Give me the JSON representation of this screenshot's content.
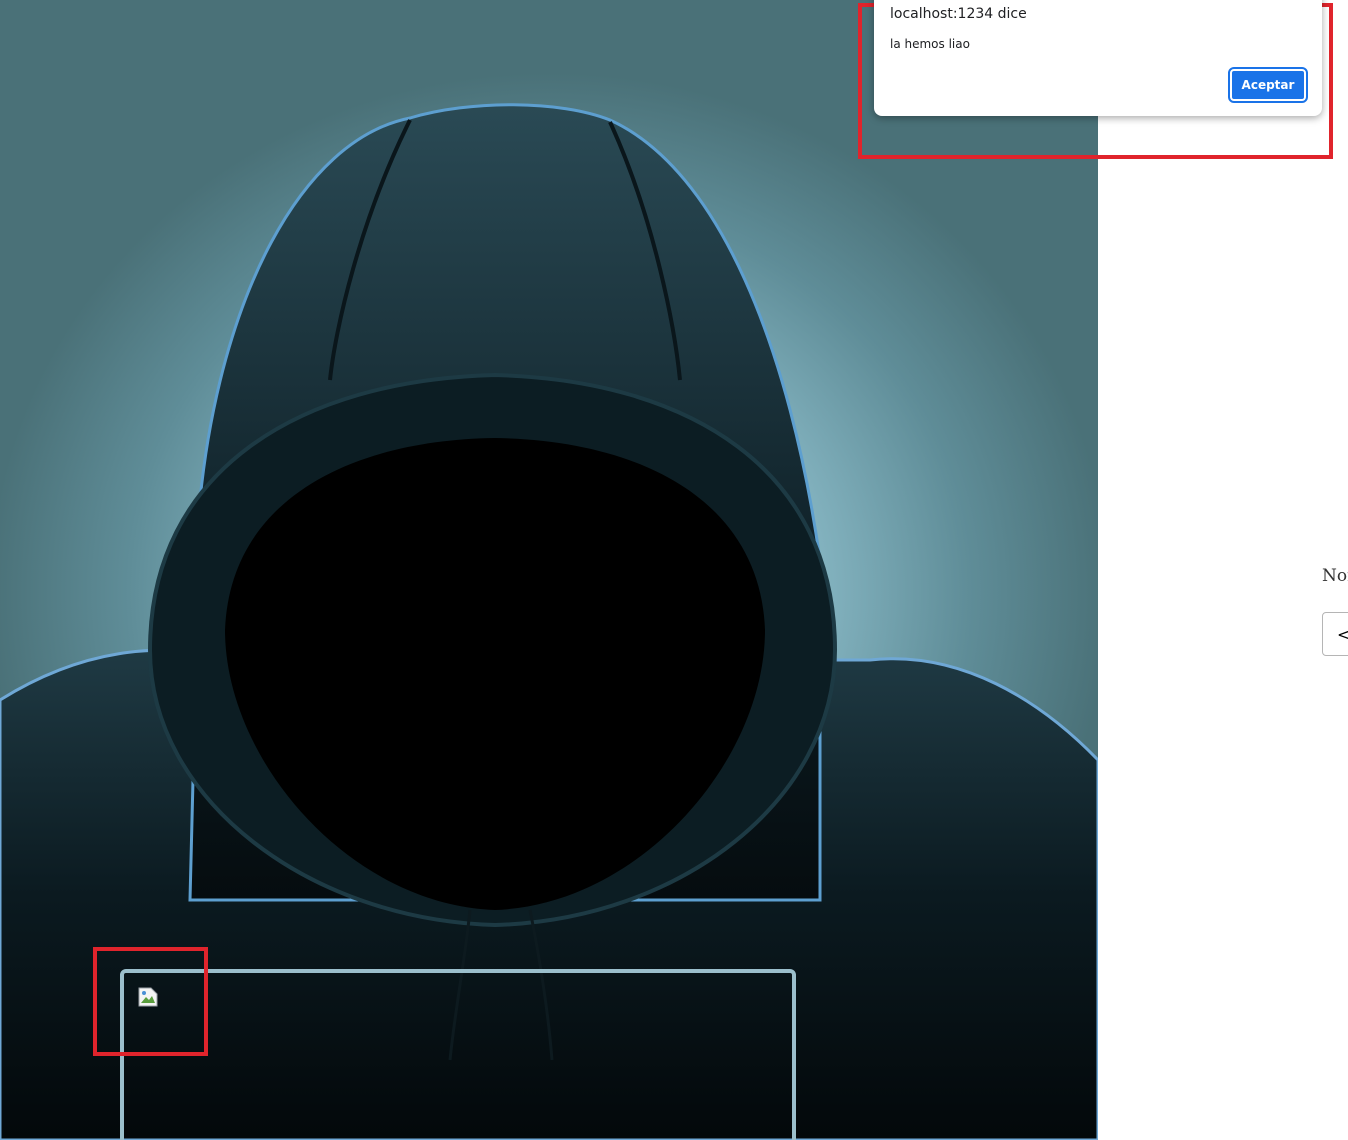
{
  "dialog": {
    "title": "localhost:1234 dice",
    "message": "la hemos liao",
    "accept_label": "Aceptar"
  },
  "form": {
    "label_partial": "Nor",
    "input_value_partial": "<i"
  },
  "colors": {
    "dialog_button": "#1a73e8",
    "highlight": "#e0242c",
    "content_box_border": "#9bbfcc"
  },
  "icons": {
    "broken_image": "broken-image-icon"
  }
}
